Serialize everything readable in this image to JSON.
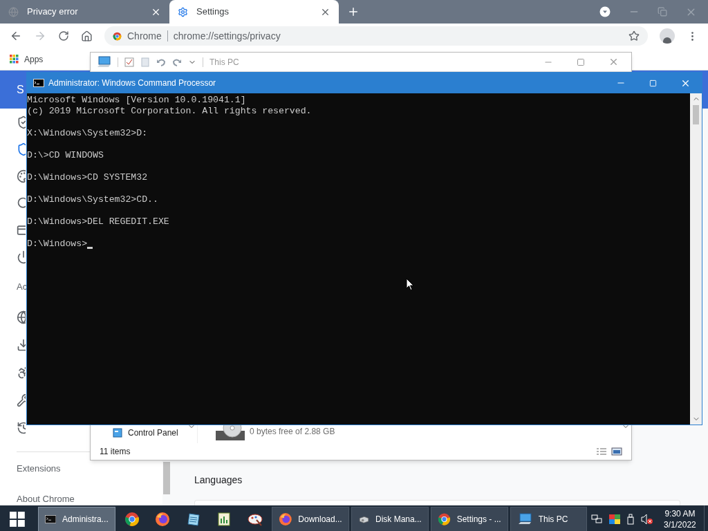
{
  "browser": {
    "tabs": [
      {
        "title": "Privacy error",
        "kind": "error",
        "selected": false
      },
      {
        "title": "Settings",
        "kind": "settings",
        "selected": true
      }
    ],
    "address": {
      "origin": "Chrome",
      "url": "chrome://settings/privacy"
    },
    "bookmarks": [
      "Apps"
    ],
    "settings": {
      "header_title": "S",
      "section_label": "Ac",
      "nav_items": [
        "Extensions",
        "About Chrome"
      ],
      "content_heading": "Languages"
    }
  },
  "explorer": {
    "title": "This PC",
    "nav_item": "Control Panel",
    "drive_detail": "0 bytes free of 2.88 GB",
    "status": "11 items"
  },
  "cmd": {
    "title": "Administrator: Windows Command Processor",
    "blocks": [
      [
        "Microsoft Windows [Version 10.0.19041.1]",
        "(c) 2019 Microsoft Corporation. All rights reserved."
      ],
      [
        "X:\\Windows\\System32>D:"
      ],
      [
        "D:\\>CD WINDOWS"
      ],
      [
        "D:\\Windows>CD SYSTEM32"
      ],
      [
        "D:\\Windows\\System32>CD.."
      ],
      [
        "D:\\Windows>DEL REGEDIT.EXE"
      ],
      [
        "D:\\Windows>"
      ]
    ]
  },
  "taskbar": {
    "items": [
      {
        "kind": "terminal",
        "label": "Administra...",
        "selected": true
      },
      {
        "kind": "chrome",
        "selected": false
      },
      {
        "kind": "firefox",
        "selected": false
      },
      {
        "kind": "notepad",
        "selected": false
      },
      {
        "kind": "sheet",
        "selected": false
      },
      {
        "kind": "paint",
        "selected": false
      },
      {
        "kind": "firefox",
        "label": "Download...",
        "selected": false
      },
      {
        "kind": "disk",
        "label": "Disk Mana...",
        "selected": false
      },
      {
        "kind": "chrome",
        "label": "Settings - ...",
        "selected": false
      },
      {
        "kind": "computer",
        "label": "This PC",
        "selected": false
      }
    ],
    "time": "9:30 AM",
    "date": "3/1/2022"
  }
}
